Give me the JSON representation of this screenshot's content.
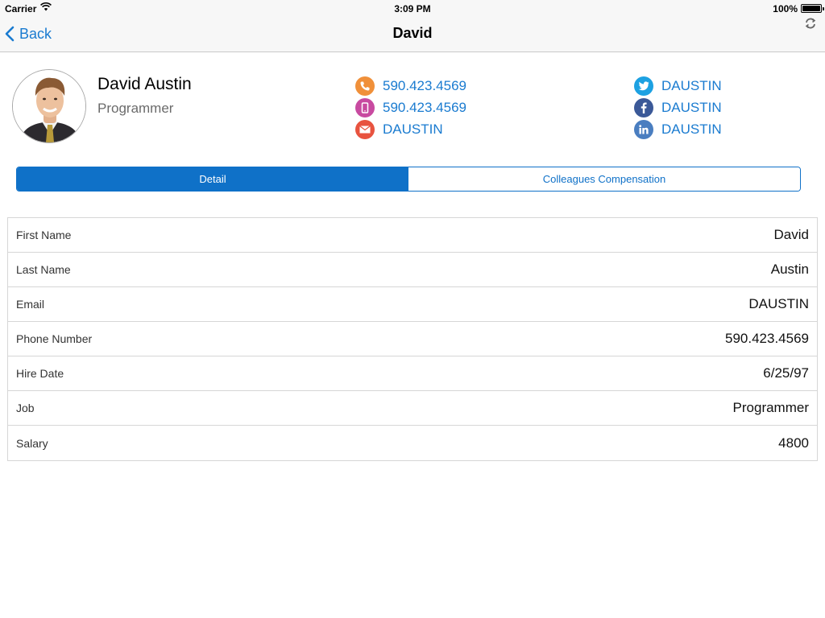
{
  "status_bar": {
    "carrier": "Carrier",
    "time": "3:09 PM",
    "battery": "100%"
  },
  "nav": {
    "back_label": "Back",
    "title": "David"
  },
  "employee": {
    "name": "David Austin",
    "job": "Programmer"
  },
  "contacts": {
    "phone": "590.423.4569",
    "mobile": "590.423.4569",
    "email": "DAUSTIN",
    "twitter": "DAUSTIN",
    "facebook": "DAUSTIN",
    "linkedin": "DAUSTIN"
  },
  "tabs": [
    {
      "label": "Detail",
      "selected": true
    },
    {
      "label": "Colleagues Compensation",
      "selected": false
    }
  ],
  "details": [
    {
      "label": "First Name",
      "value": "David"
    },
    {
      "label": "Last Name",
      "value": "Austin"
    },
    {
      "label": "Email",
      "value": "DAUSTIN"
    },
    {
      "label": "Phone Number",
      "value": "590.423.4569"
    },
    {
      "label": "Hire Date",
      "value": "6/25/97"
    },
    {
      "label": "Job",
      "value": "Programmer"
    },
    {
      "label": "Salary",
      "value": "4800"
    }
  ],
  "colors": {
    "accent": "#1a7bd0",
    "segment_active": "#0f71c8",
    "phone_icon": "#f0903a",
    "mobile_icon": "#c84aa0",
    "email_icon": "#e8533f",
    "twitter_icon": "#1da1e2",
    "facebook_icon": "#3b5998",
    "linkedin_icon": "#4a7ec0"
  },
  "icons": [
    "wifi-icon",
    "battery-icon",
    "back-chevron-icon",
    "refresh-icon",
    "phone-icon",
    "mobile-icon",
    "email-icon",
    "twitter-icon",
    "facebook-icon",
    "linkedin-icon"
  ]
}
